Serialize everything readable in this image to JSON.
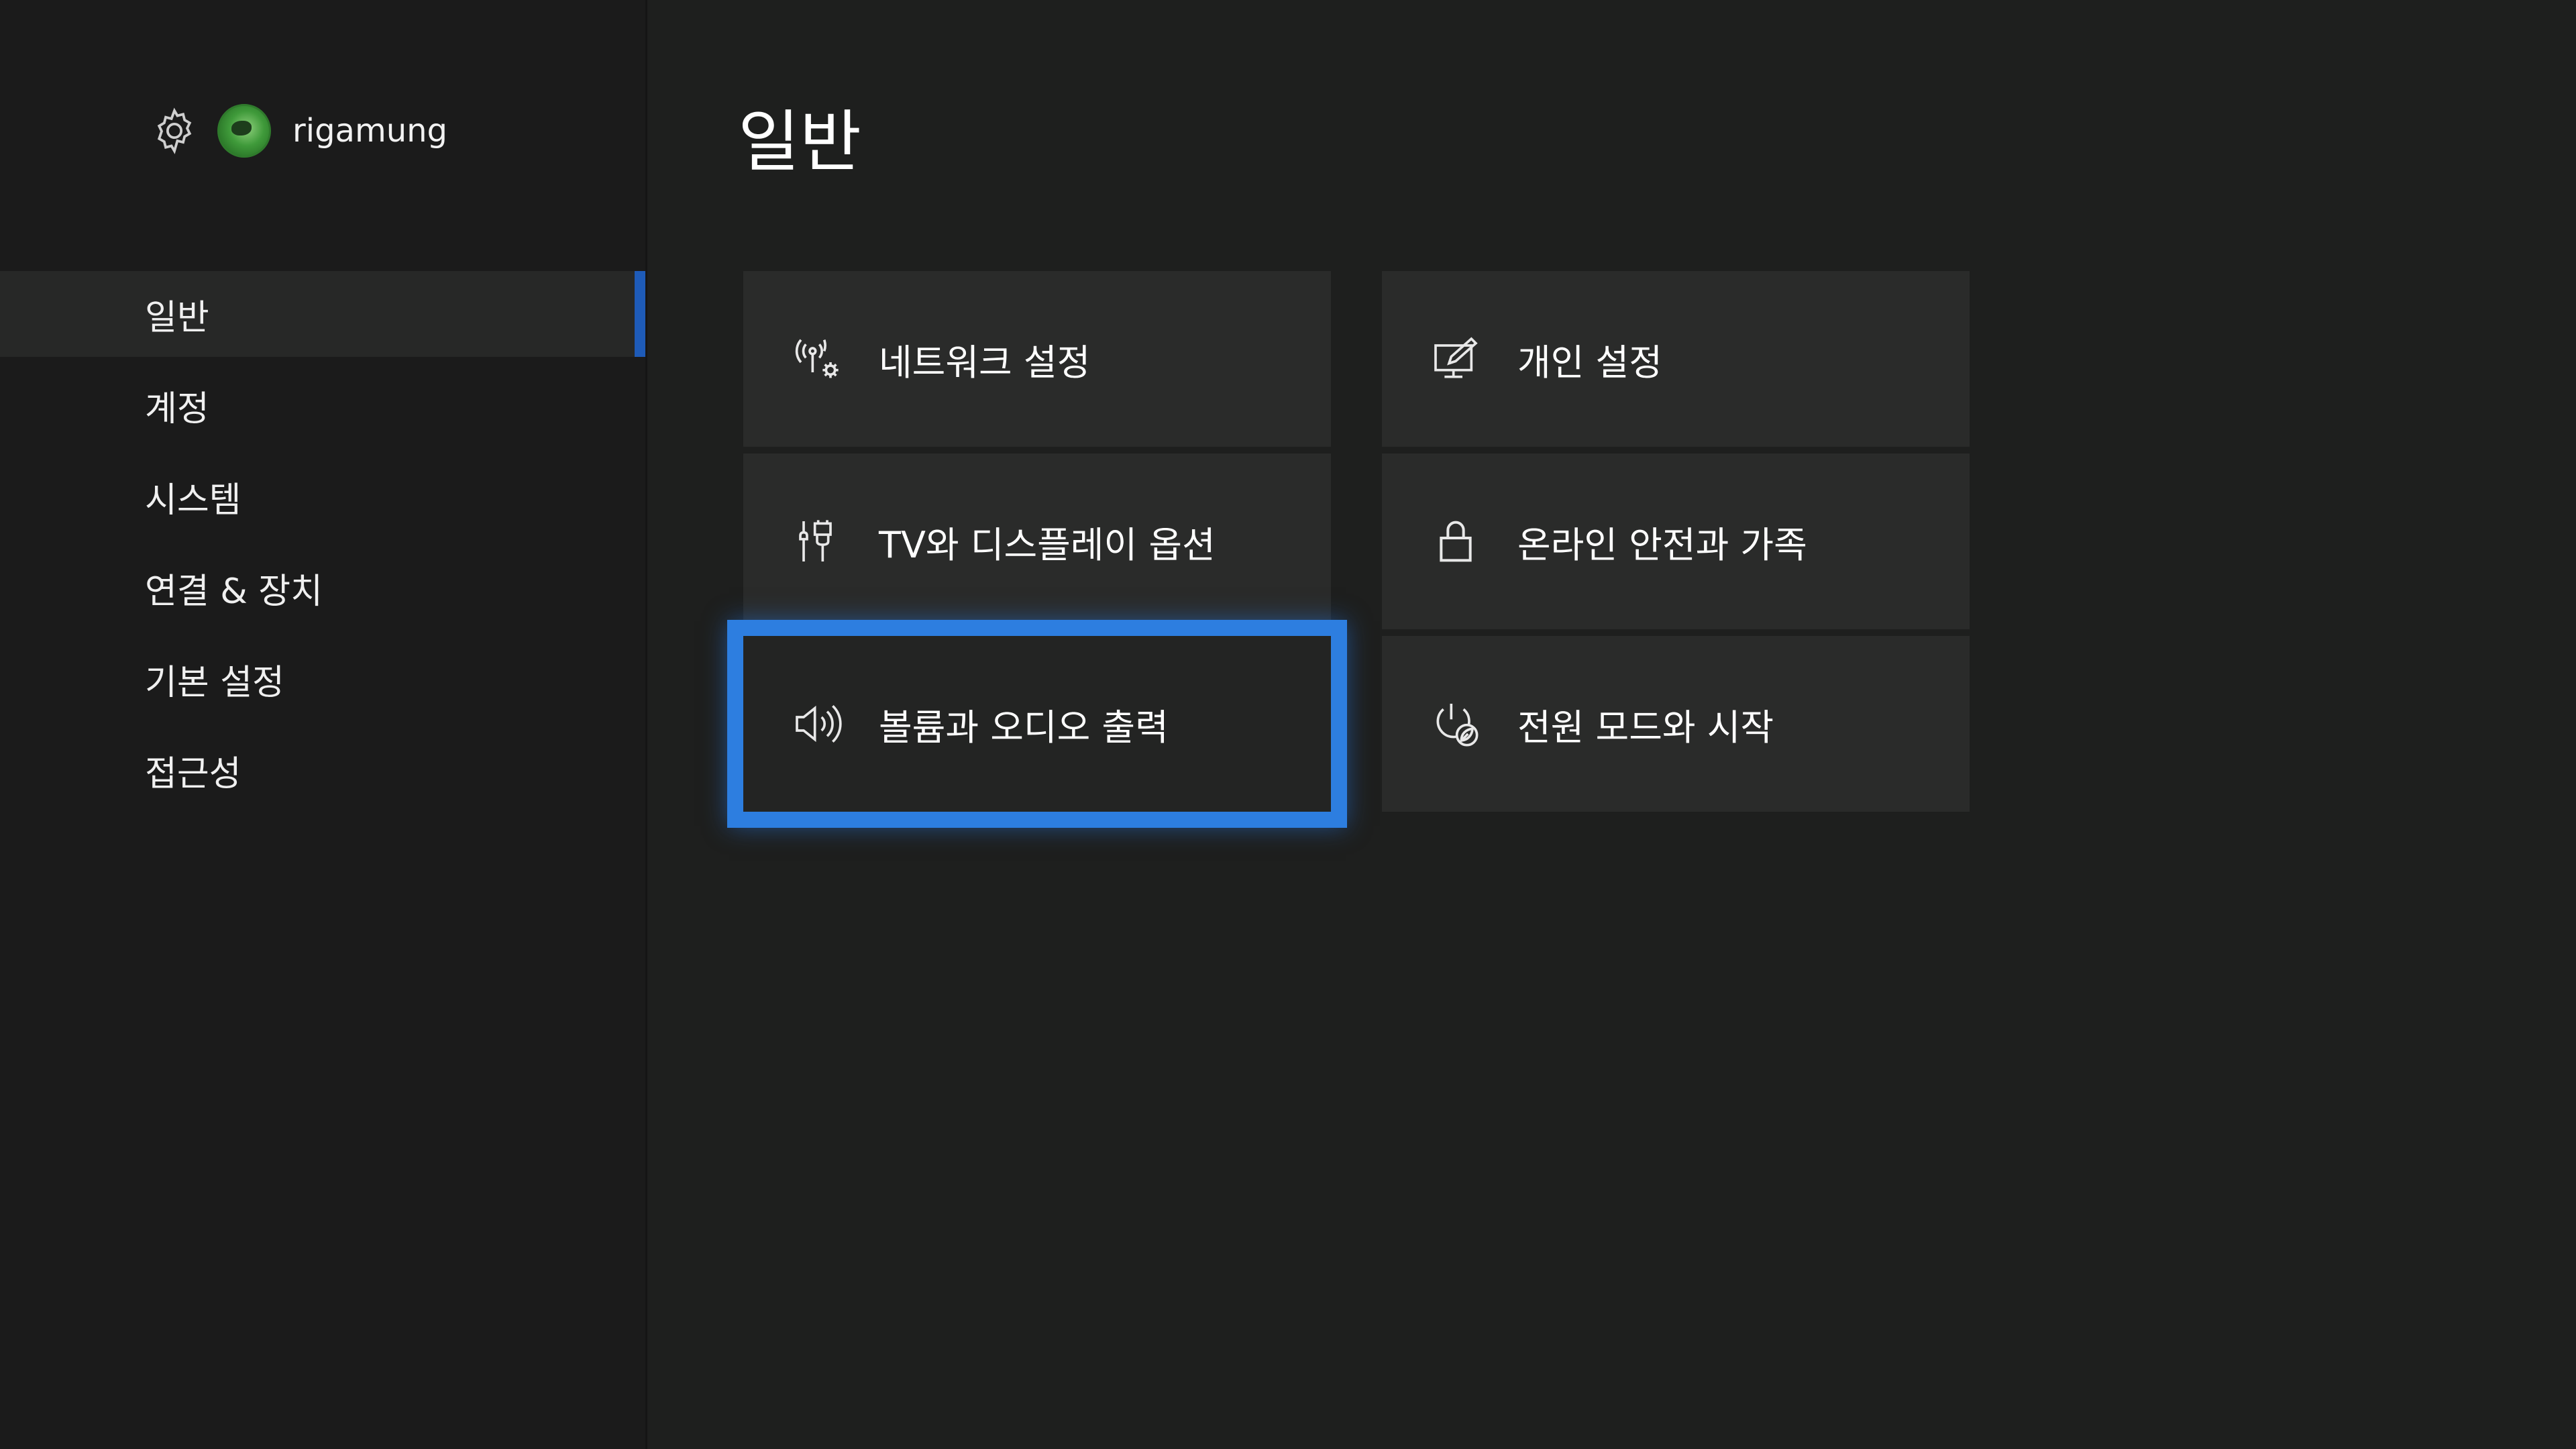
{
  "profile": {
    "settings_icon": "gear-icon",
    "avatar_icon": "green-globe-avatar",
    "gamertag": "rigamung"
  },
  "nav": {
    "items": [
      {
        "label": "일반",
        "active": true
      },
      {
        "label": "계정",
        "active": false
      },
      {
        "label": "시스템",
        "active": false
      },
      {
        "label": "연결 & 장치",
        "active": false
      },
      {
        "label": "기본 설정",
        "active": false
      },
      {
        "label": "접근성",
        "active": false
      }
    ]
  },
  "main": {
    "title": "일반",
    "tiles": [
      {
        "label": "네트워크 설정",
        "icon": "network-gear-icon"
      },
      {
        "label": "개인 설정",
        "icon": "personalize-pen-icon"
      },
      {
        "label": "TV와 디스플레이 옵션",
        "icon": "hdmi-cable-icon"
      },
      {
        "label": "온라인 안전과 가족",
        "icon": "lock-icon"
      },
      {
        "label": "볼륨과 오디오 출력",
        "icon": "speaker-icon",
        "focused": true
      },
      {
        "label": "전원 모드와 시작",
        "icon": "power-leaf-icon"
      }
    ]
  },
  "colors": {
    "background": "#1e1f1e",
    "sidebar": "#1b1b1b",
    "tile": "#2a2b2a",
    "focus": "#2d7ee0",
    "nav_indicator": "#1e5bb8"
  }
}
